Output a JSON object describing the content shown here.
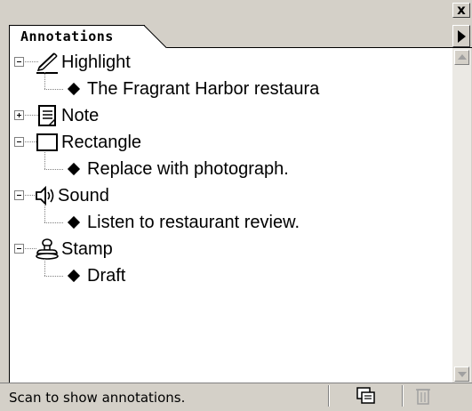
{
  "palette": {
    "close_glyph": "x",
    "tab_label": "Annotations",
    "menu_icon": "palette-menu-triangle-icon"
  },
  "tree": [
    {
      "type": "Highlight",
      "icon": "highlight-pen-icon",
      "expanded": true,
      "child": "The Fragrant Harbor restaura"
    },
    {
      "type": "Note",
      "icon": "note-icon",
      "expanded": false,
      "child": null
    },
    {
      "type": "Rectangle",
      "icon": "rectangle-icon",
      "expanded": true,
      "child": "Replace with photograph."
    },
    {
      "type": "Sound",
      "icon": "sound-speaker-icon",
      "expanded": true,
      "child": "Listen to restaurant review."
    },
    {
      "type": "Stamp",
      "icon": "stamp-icon",
      "expanded": true,
      "child": "Draft"
    }
  ],
  "status": {
    "message": "Scan to show annotations.",
    "scan_button_icon": "scan-icon",
    "delete_button_icon": "trash-icon"
  },
  "colors": {
    "chrome": "#d4d0c8",
    "panel": "#ffffff",
    "disabled": "#a0a0a0"
  }
}
